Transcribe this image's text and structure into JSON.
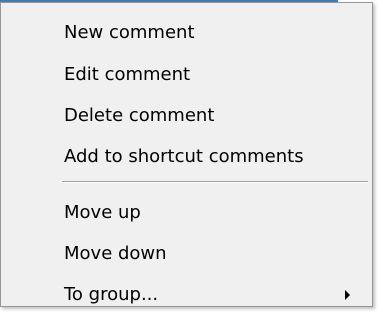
{
  "context_menu": {
    "groups": [
      {
        "items": [
          {
            "label": "New comment"
          },
          {
            "label": "Edit comment"
          },
          {
            "label": "Delete comment"
          },
          {
            "label": "Add to shortcut comments"
          }
        ]
      },
      {
        "items": [
          {
            "label": "Move up"
          },
          {
            "label": "Move down"
          },
          {
            "label": "To group...",
            "has_submenu": true,
            "submenu_icon": "chevron-right-icon"
          }
        ]
      }
    ]
  },
  "colors": {
    "menu_background": "#f0f0f0",
    "menu_border": "#979797",
    "window_accent": "#3c7fb1"
  }
}
